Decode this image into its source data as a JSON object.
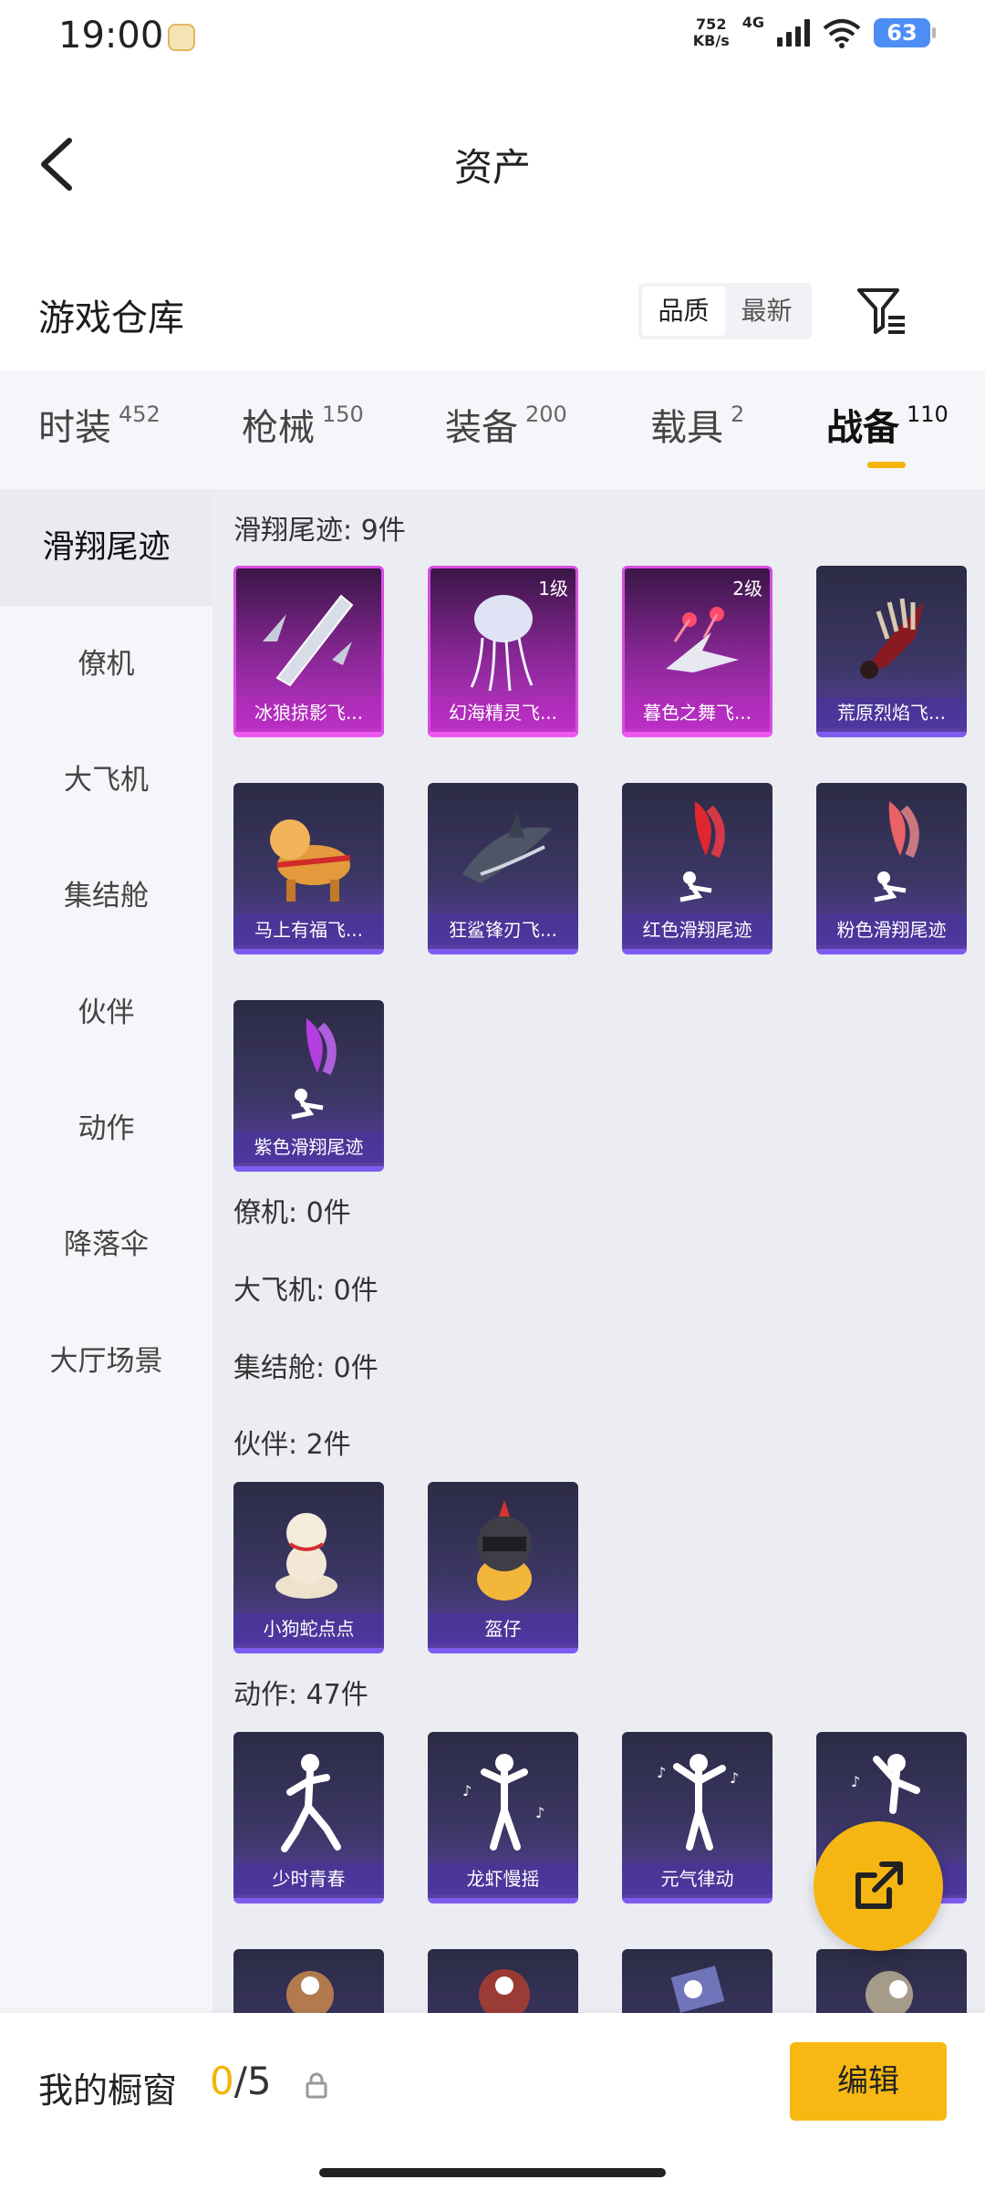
{
  "status_bar": {
    "time": "19:00",
    "net_speed_value": "752",
    "net_speed_unit": "KB/s",
    "network": "4G",
    "battery": "63"
  },
  "header": {
    "title": "资产",
    "back_icon": "chevron-left-icon"
  },
  "section": {
    "title": "游戏仓库",
    "sort_options": [
      "品质",
      "最新"
    ],
    "sort_selected": "品质",
    "filter_icon": "filter-icon"
  },
  "tabs": [
    {
      "label": "时装",
      "count": "452"
    },
    {
      "label": "枪械",
      "count": "150"
    },
    {
      "label": "装备",
      "count": "200"
    },
    {
      "label": "载具",
      "count": "2"
    },
    {
      "label": "战备",
      "count": "110"
    }
  ],
  "active_tab": "战备",
  "side_nav": {
    "items": [
      "滑翔尾迹",
      "僚机",
      "大飞机",
      "集结舱",
      "伙伴",
      "动作",
      "降落伞",
      "大厅场景"
    ],
    "active": "滑翔尾迹"
  },
  "groups": {
    "glide": {
      "title": "滑翔尾迹: 9件",
      "items": [
        {
          "label": "冰狼掠影飞...",
          "level": ""
        },
        {
          "label": "幻海精灵飞...",
          "level": "1级"
        },
        {
          "label": "暮色之舞飞...",
          "level": "2级"
        },
        {
          "label": "荒原烈焰飞...",
          "level": ""
        },
        {
          "label": "马上有福飞...",
          "level": ""
        },
        {
          "label": "狂鲨锋刃飞...",
          "level": ""
        },
        {
          "label": "红色滑翔尾迹",
          "level": ""
        },
        {
          "label": "粉色滑翔尾迹",
          "level": ""
        },
        {
          "label": "紫色滑翔尾迹",
          "level": ""
        }
      ]
    },
    "wingman": {
      "title": "僚机: 0件"
    },
    "plane": {
      "title": "大飞机: 0件"
    },
    "pod": {
      "title": "集结舱: 0件"
    },
    "companion": {
      "title": "伙伴: 2件",
      "items": [
        {
          "label": "小狗蛇点点"
        },
        {
          "label": "盔仔"
        }
      ]
    },
    "emote": {
      "title": "动作: 47件",
      "items": [
        {
          "label": "少时青春"
        },
        {
          "label": "龙虾慢摇"
        },
        {
          "label": "元气律动"
        },
        {
          "label": ""
        }
      ]
    }
  },
  "fab_icon": "share-icon",
  "bottom": {
    "showcase_label": "我的橱窗",
    "showcase_current": "0",
    "showcase_total": "/5",
    "lock_icon": "lock-icon",
    "edit_label": "编辑"
  },
  "colors": {
    "accent": "#f6b612",
    "epic_card": "#c036c9",
    "standard_card": "#5b3fa2"
  }
}
